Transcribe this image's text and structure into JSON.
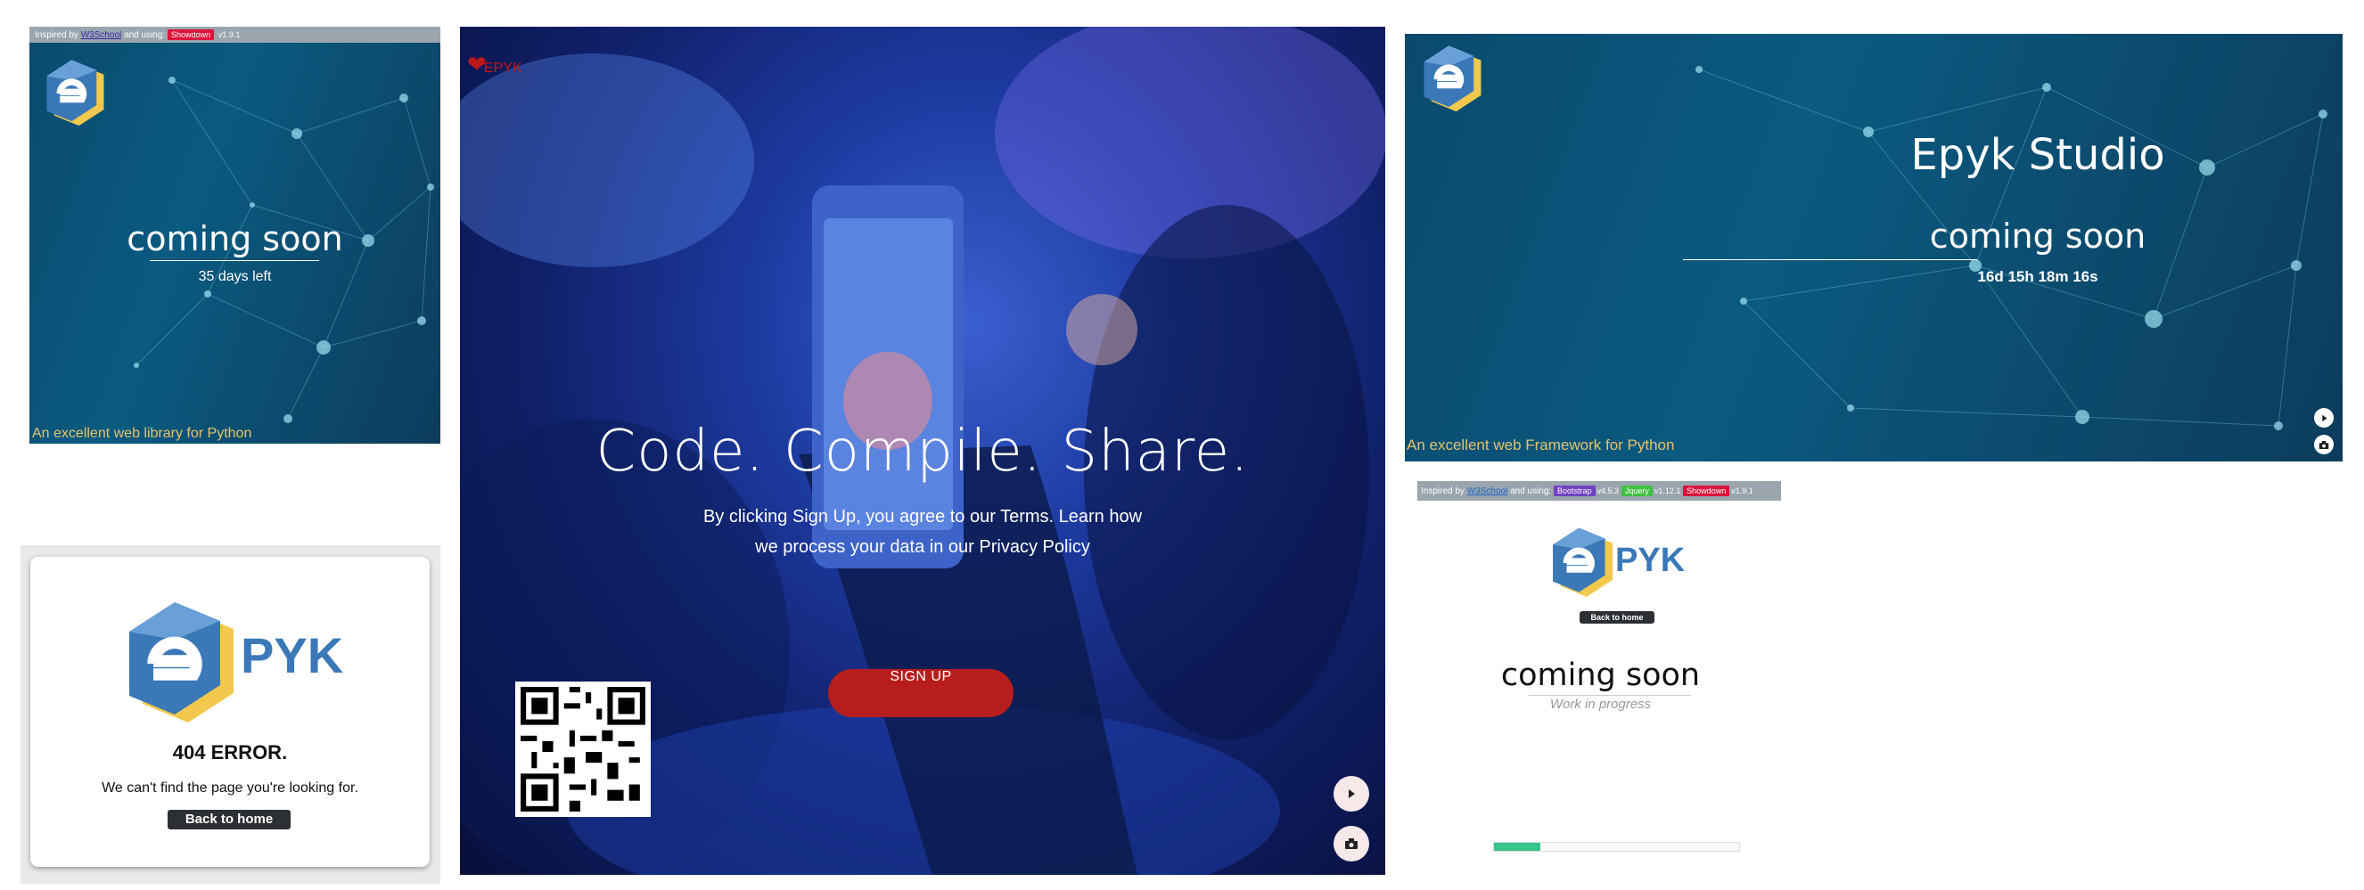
{
  "panel1": {
    "inspired_prefix": "Inspired by",
    "inspired_link": "W3School",
    "inspired_mid": "and using:",
    "lib_badge": "Showdown",
    "lib_version": "v1.9.1",
    "title": "coming soon",
    "days_left": "35 days left",
    "footer": "An excellent web library for Python"
  },
  "panel2": {
    "logo_text": "PYK",
    "error_title": "404 ERROR.",
    "message": "We can't find the page you're looking for.",
    "back_label": "Back to home"
  },
  "panel3": {
    "logo_text": "EPYK",
    "headline": "Code. Compile. Share.",
    "sub_line1": "By clicking Sign Up, you agree to our Terms. Learn how",
    "sub_line2": "we process your data in our Privacy Policy",
    "signup_label": "SIGN UP"
  },
  "panel4": {
    "studio_title": "Epyk Studio",
    "title": "coming soon",
    "countdown": "16d 15h 18m 16s",
    "footer": "An excellent web Framework for Python"
  },
  "panel5": {
    "inspired_prefix": "Inspired by",
    "inspired_link": "W3School",
    "inspired_mid": "and using:",
    "badges": [
      {
        "label": "Bootstrap",
        "version": "v4.5.3",
        "color": "#6f42c1"
      },
      {
        "label": "Jquery",
        "version": "v1.12.1",
        "color": "#40c040"
      },
      {
        "label": "Showdown",
        "version": "v1.9.1",
        "color": "#dc143c"
      }
    ],
    "logo_text": "PYK",
    "back_label": "Back to home",
    "title": "coming soon",
    "subtitle": "Work in progress",
    "progress": 0.19
  },
  "colors": {
    "accent_red": "#b81d1d",
    "badge_red": "#dc143c",
    "footer_gold": "#e6c36a",
    "logo_blue": "#3b78b8",
    "logo_yellow": "#f2c94c"
  },
  "icons": {
    "play": "play-icon",
    "camera": "camera-icon",
    "heart": "heart-icon",
    "qr": "qr-code-icon"
  }
}
